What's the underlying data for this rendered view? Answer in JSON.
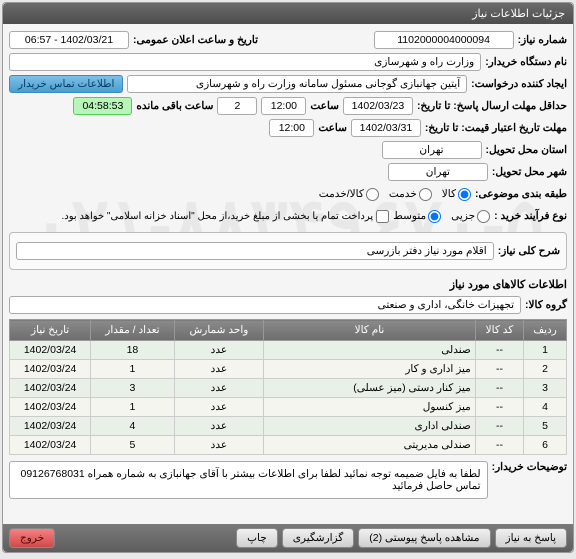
{
  "window_title": "جزئیات اطلاعات نیاز",
  "fields": {
    "need_no_label": "شماره نیاز:",
    "need_no": "1102000004000094",
    "announce_label": "تاریخ و ساعت اعلان عمومی:",
    "announce_value": "1402/03/21 - 06:57",
    "buyer_label": "نام دستگاه خریدار:",
    "buyer_value": "وزارت راه و شهرسازی",
    "creator_label": "ایجاد کننده درخواست:",
    "creator_value": "آیتین جهانبازی گوجانی مسئول سامانه وزارت راه و شهرسازی",
    "contact_btn": "اطلاعات تماس خریدار",
    "deadline_reply_label": "حداقل مهلت ارسال پاسخ: تا تاریخ:",
    "deadline_reply_date": "1402/03/23",
    "hour_label": "ساعت",
    "deadline_reply_hour": "12:00",
    "days_left": "2",
    "remaining_label": "ساعت باقی مانده",
    "countdown": "04:58:53",
    "validity_label": "مهلت تاریخ اعتبار قیمت: تا تاریخ:",
    "validity_date": "1402/03/31",
    "validity_hour": "12:00",
    "deliver_state_label": "استان محل تحویل:",
    "deliver_state": "تهران",
    "deliver_city_label": "شهر محل تحویل:",
    "deliver_city": "تهران",
    "classification_label": "طبقه بندی موضوعی:",
    "class_goods": "کالا",
    "class_service": "خدمت",
    "class_goods_service": "کالا/خدمت",
    "buy_process_label": "نوع فرآیند خرید :",
    "proc_partial": "جزیی",
    "proc_medium": "متوسط",
    "proc_note": "پرداخت تمام یا بخشی از مبلغ خرید،از محل \"اسناد خزانه اسلامی\" خواهد بود.",
    "summary_label": "شرح کلی نیاز:",
    "summary_value": "اقلام مورد نیاز دفتر بازرسی",
    "goods_heading": "اطلاعات کالاهای مورد نیاز",
    "group_label": "گروه کالا:",
    "group_value": "تجهیزات خانگی، اداری و صنعتی",
    "buyer_note_label": "توضیحات خریدار:",
    "buyer_note_value": "لطفا به فایل ضمیمه توجه نمائید لطفا برای اطلاعات بیشتر با آقای جهانبازی به شماره همراه 09126768031 تماس حاصل فرمائید"
  },
  "table": {
    "headers": {
      "row": "ردیف",
      "code": "کد کالا",
      "name": "نام کالا",
      "unit": "واحد شمارش",
      "qty": "تعداد / مقدار",
      "date": "تاریخ نیاز"
    },
    "rows": [
      {
        "n": "1",
        "code": "--",
        "name": "صندلی",
        "unit": "عدد",
        "qty": "18",
        "date": "1402/03/24"
      },
      {
        "n": "2",
        "code": "--",
        "name": "میز اداری و کار",
        "unit": "عدد",
        "qty": "1",
        "date": "1402/03/24"
      },
      {
        "n": "3",
        "code": "--",
        "name": "میز کنار دستی (میز عسلی)",
        "unit": "عدد",
        "qty": "3",
        "date": "1402/03/24"
      },
      {
        "n": "4",
        "code": "--",
        "name": "میز کنسول",
        "unit": "عدد",
        "qty": "1",
        "date": "1402/03/24"
      },
      {
        "n": "5",
        "code": "--",
        "name": "صندلی اداری",
        "unit": "عدد",
        "qty": "4",
        "date": "1402/03/24"
      },
      {
        "n": "6",
        "code": "--",
        "name": "صندلی مدیریتی",
        "unit": "عدد",
        "qty": "5",
        "date": "1402/03/24"
      }
    ]
  },
  "footer": {
    "reply": "پاسخ به نیاز",
    "view_reply": "مشاهده پاسخ پیوستی (2)",
    "report": "گزارشگیری",
    "print": "چاپ",
    "exit": "خروج"
  }
}
